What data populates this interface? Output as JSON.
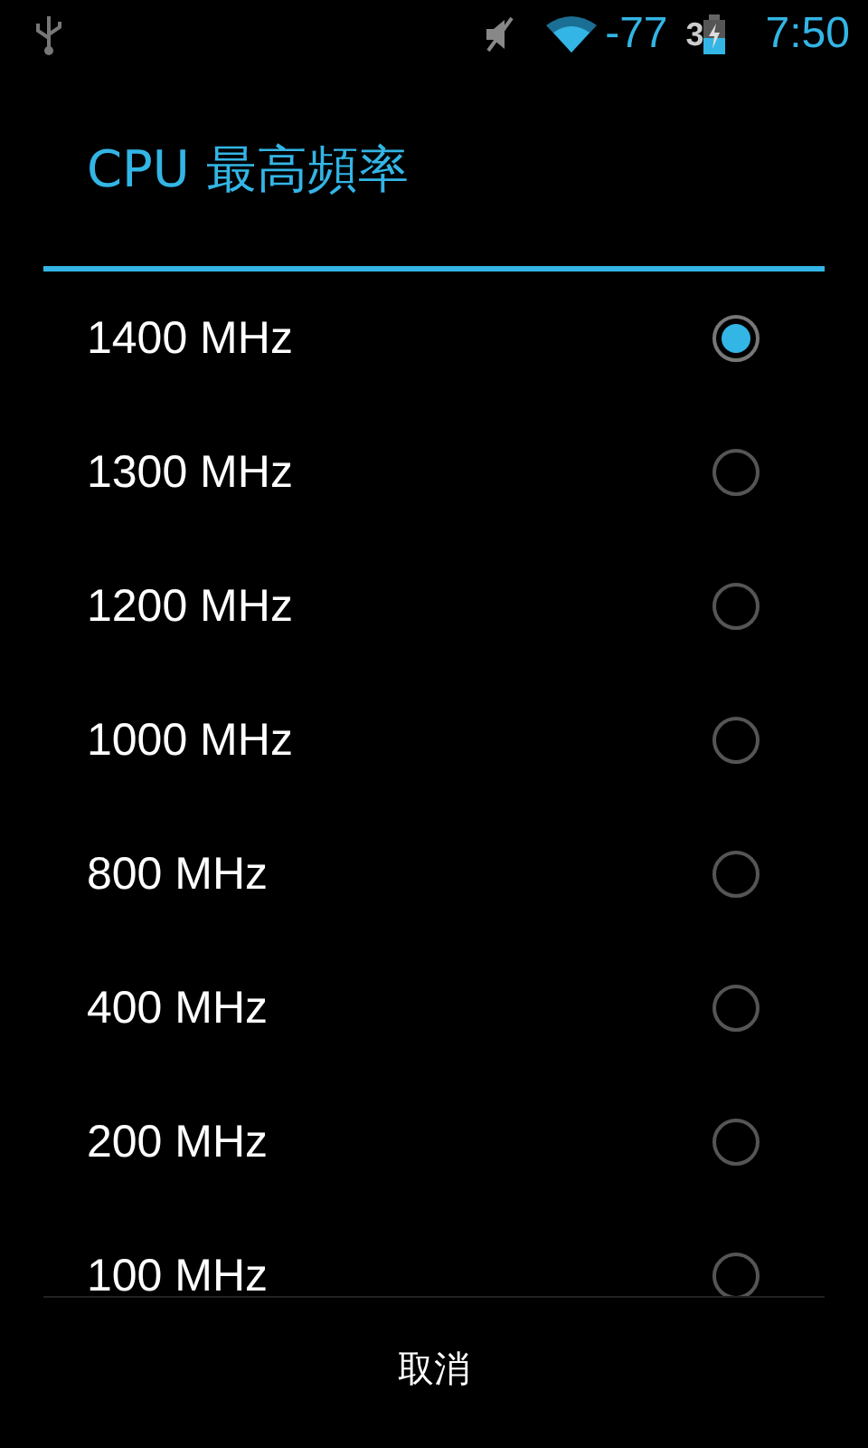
{
  "status_bar": {
    "wifi_signal": "-77",
    "battery_text": "3",
    "time": "7:50"
  },
  "dialog": {
    "title": "CPU 最高頻率",
    "options": [
      {
        "label": "1400 MHz",
        "selected": true
      },
      {
        "label": "1300 MHz",
        "selected": false
      },
      {
        "label": "1200 MHz",
        "selected": false
      },
      {
        "label": "1000 MHz",
        "selected": false
      },
      {
        "label": "800 MHz",
        "selected": false
      },
      {
        "label": "400 MHz",
        "selected": false
      },
      {
        "label": "200 MHz",
        "selected": false
      },
      {
        "label": "100 MHz",
        "selected": false
      }
    ],
    "buttons": [
      "取消"
    ]
  }
}
